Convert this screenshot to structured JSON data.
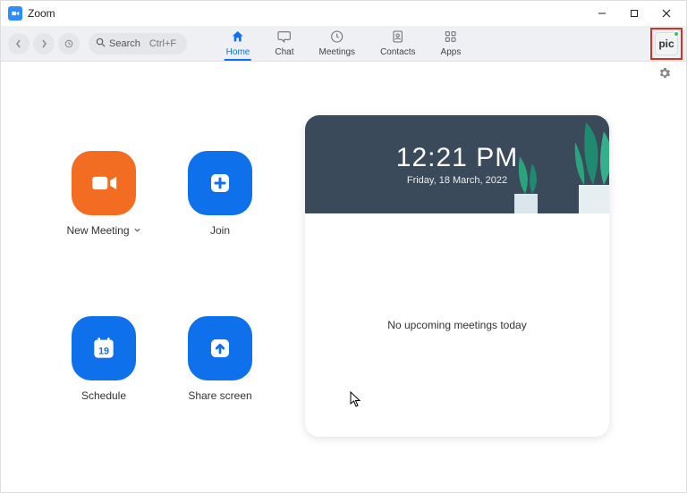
{
  "window": {
    "title": "Zoom"
  },
  "toolbar": {
    "search_label": "Search",
    "search_hint": "Ctrl+F"
  },
  "tabs": {
    "home": "Home",
    "chat": "Chat",
    "meetings": "Meetings",
    "contacts": "Contacts",
    "apps": "Apps"
  },
  "avatar": {
    "text": "pic"
  },
  "actions": {
    "new_meeting": "New Meeting",
    "join": "Join",
    "schedule": "Schedule",
    "share_screen": "Share screen",
    "schedule_day": "19"
  },
  "panel": {
    "time": "12:21 PM",
    "date": "Friday, 18 March, 2022",
    "empty": "No upcoming meetings today"
  }
}
